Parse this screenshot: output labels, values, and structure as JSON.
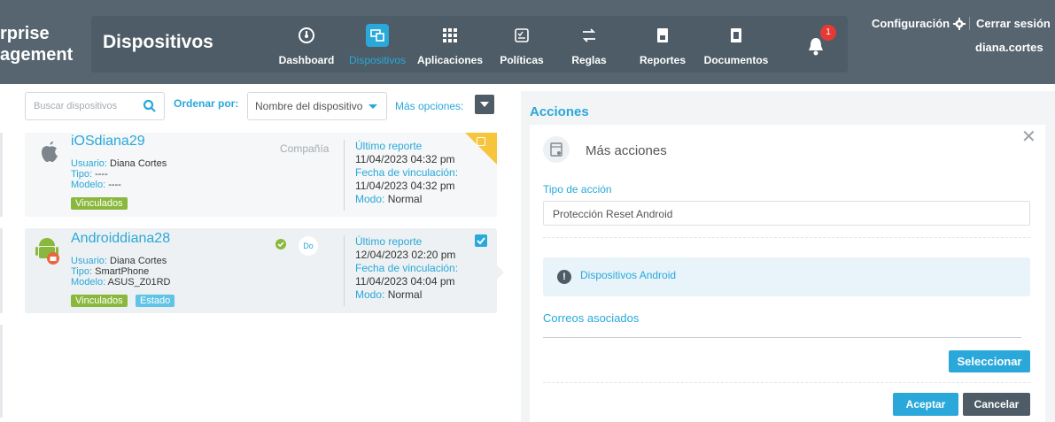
{
  "brand": {
    "line1": "rprise",
    "line2": "agement"
  },
  "header": {
    "section_title": "Dispositivos",
    "nav": [
      {
        "label": "Dashboard",
        "icon": "dashboard-gauge-icon"
      },
      {
        "label": "Dispositivos",
        "icon": "devices-icon",
        "active": true
      },
      {
        "label": "Aplicaciones",
        "icon": "apps-grid-icon"
      },
      {
        "label": "Políticas",
        "icon": "policies-icon"
      },
      {
        "label": "Reglas",
        "icon": "rules-icon"
      },
      {
        "label": "Reportes",
        "icon": "reports-icon"
      },
      {
        "label": "Documentos",
        "icon": "documents-icon"
      }
    ],
    "notification_count": "1",
    "config_label": "Configuración",
    "logout_label": "Cerrar sesión",
    "username": "diana.cortes"
  },
  "toolbar": {
    "search_placeholder": "Buscar dispositivos",
    "sort_label": "Ordenar por:",
    "sort_value": "Nombre del dispositivo",
    "more_options_label": "Más opciones:"
  },
  "devices": [
    {
      "name": "iOSdiana29",
      "os_icon": "apple-icon",
      "user_key": "Usuario:",
      "user_val": " Diana Cortes",
      "type_key": "Tipo:",
      "type_val": " ----",
      "model_key": "Modelo:",
      "model_val": " ----",
      "tags": [
        "Vinculados"
      ],
      "owner": "Compañía",
      "report_key": "Último reporte",
      "report_val": "11/04/2023 04:32 pm",
      "link_key": "Fecha de vinculación:",
      "link_val": "11/04/2023 04:32 pm",
      "mode_key": "Modo:",
      "mode_val": " Normal",
      "selected": false
    },
    {
      "name": "Androiddiana28",
      "os_icon": "android-icon",
      "user_key": "Usuario:",
      "user_val": " Diana Cortes",
      "type_key": "Tipo:",
      "type_val": " SmartPhone",
      "model_key": "Modelo:",
      "model_val": " ASUS_Z01RD",
      "tags": [
        "Vinculados",
        "Estado"
      ],
      "badge": "Do",
      "report_key": "Último reporte",
      "report_val": "12/04/2023 02:20 pm",
      "link_key": "Fecha de vinculación:",
      "link_val": "11/04/2023 04:04 pm",
      "mode_key": "Modo:",
      "mode_val": " Normal",
      "selected": true
    }
  ],
  "actions": {
    "title": "Acciones",
    "more_actions": "Más acciones",
    "action_type_label": "Tipo de acción",
    "action_type_value": "Protección Reset Android",
    "info_text": "Dispositivos Android",
    "emails_label": "Correos asociados",
    "select_button": "Seleccionar",
    "accept_button": "Aceptar",
    "cancel_button": "Cancelar"
  },
  "colors": {
    "accent": "#29a8d9",
    "header_bg": "#56656f",
    "tag_green": "#8ab83d",
    "tag_blue": "#5fc4e5",
    "notification_red": "#e53935"
  }
}
